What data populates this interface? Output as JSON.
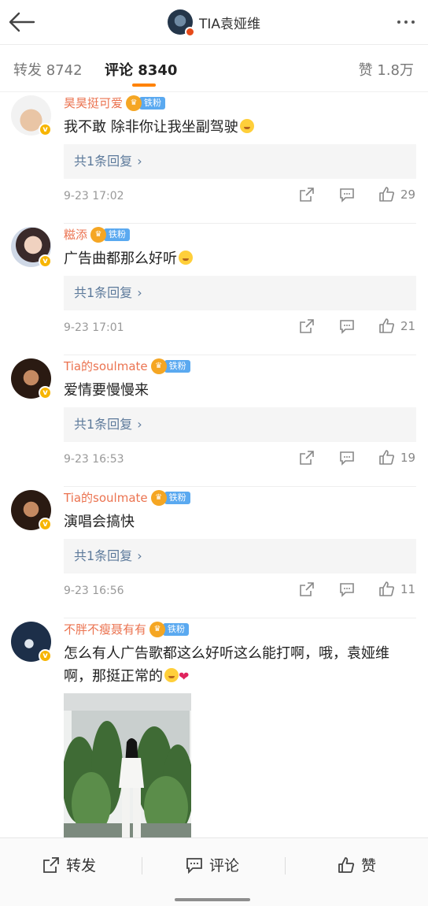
{
  "header": {
    "title": "TIA袁娅维"
  },
  "tabs": {
    "repost": "转发 8742",
    "comment": "评论 8340",
    "like": "赞 1.8万"
  },
  "fan_label": "铁粉",
  "comments": [
    {
      "name": "昊昊挺可爱",
      "text": "我不敢 除非你让我坐副驾驶",
      "reply": "共1条回复",
      "time": "9-23 17:02",
      "likes": "29"
    },
    {
      "name": "糍添",
      "text": "广告曲都那么好听",
      "reply": "共1条回复",
      "time": "9-23 17:01",
      "likes": "21"
    },
    {
      "name": "Tia的soulmate",
      "text": "爱情要慢慢来",
      "reply": "共1条回复",
      "time": "9-23 16:53",
      "likes": "19"
    },
    {
      "name": "Tia的soulmate",
      "text": "演唱会搞快",
      "reply": "共1条回复",
      "time": "9-23 16:56",
      "likes": "11"
    },
    {
      "name": "不胖不瘦聂有有",
      "text": "怎么有人广告歌都这么好听这么能打啊，哦，袁娅维啊，那挺正常的"
    }
  ],
  "bottom": {
    "repost": "转发",
    "comment": "评论",
    "like": "赞"
  },
  "colors": {
    "accent": "#ff8200",
    "username": "#eb7350",
    "link": "#5d7a9b",
    "fan_badge": "#5aa9f0"
  },
  "icons": [
    "back-arrow-icon",
    "more-icon",
    "share-icon",
    "comment-icon",
    "thumbs-up-icon",
    "chevron-right-icon",
    "verified-badge-icon"
  ]
}
